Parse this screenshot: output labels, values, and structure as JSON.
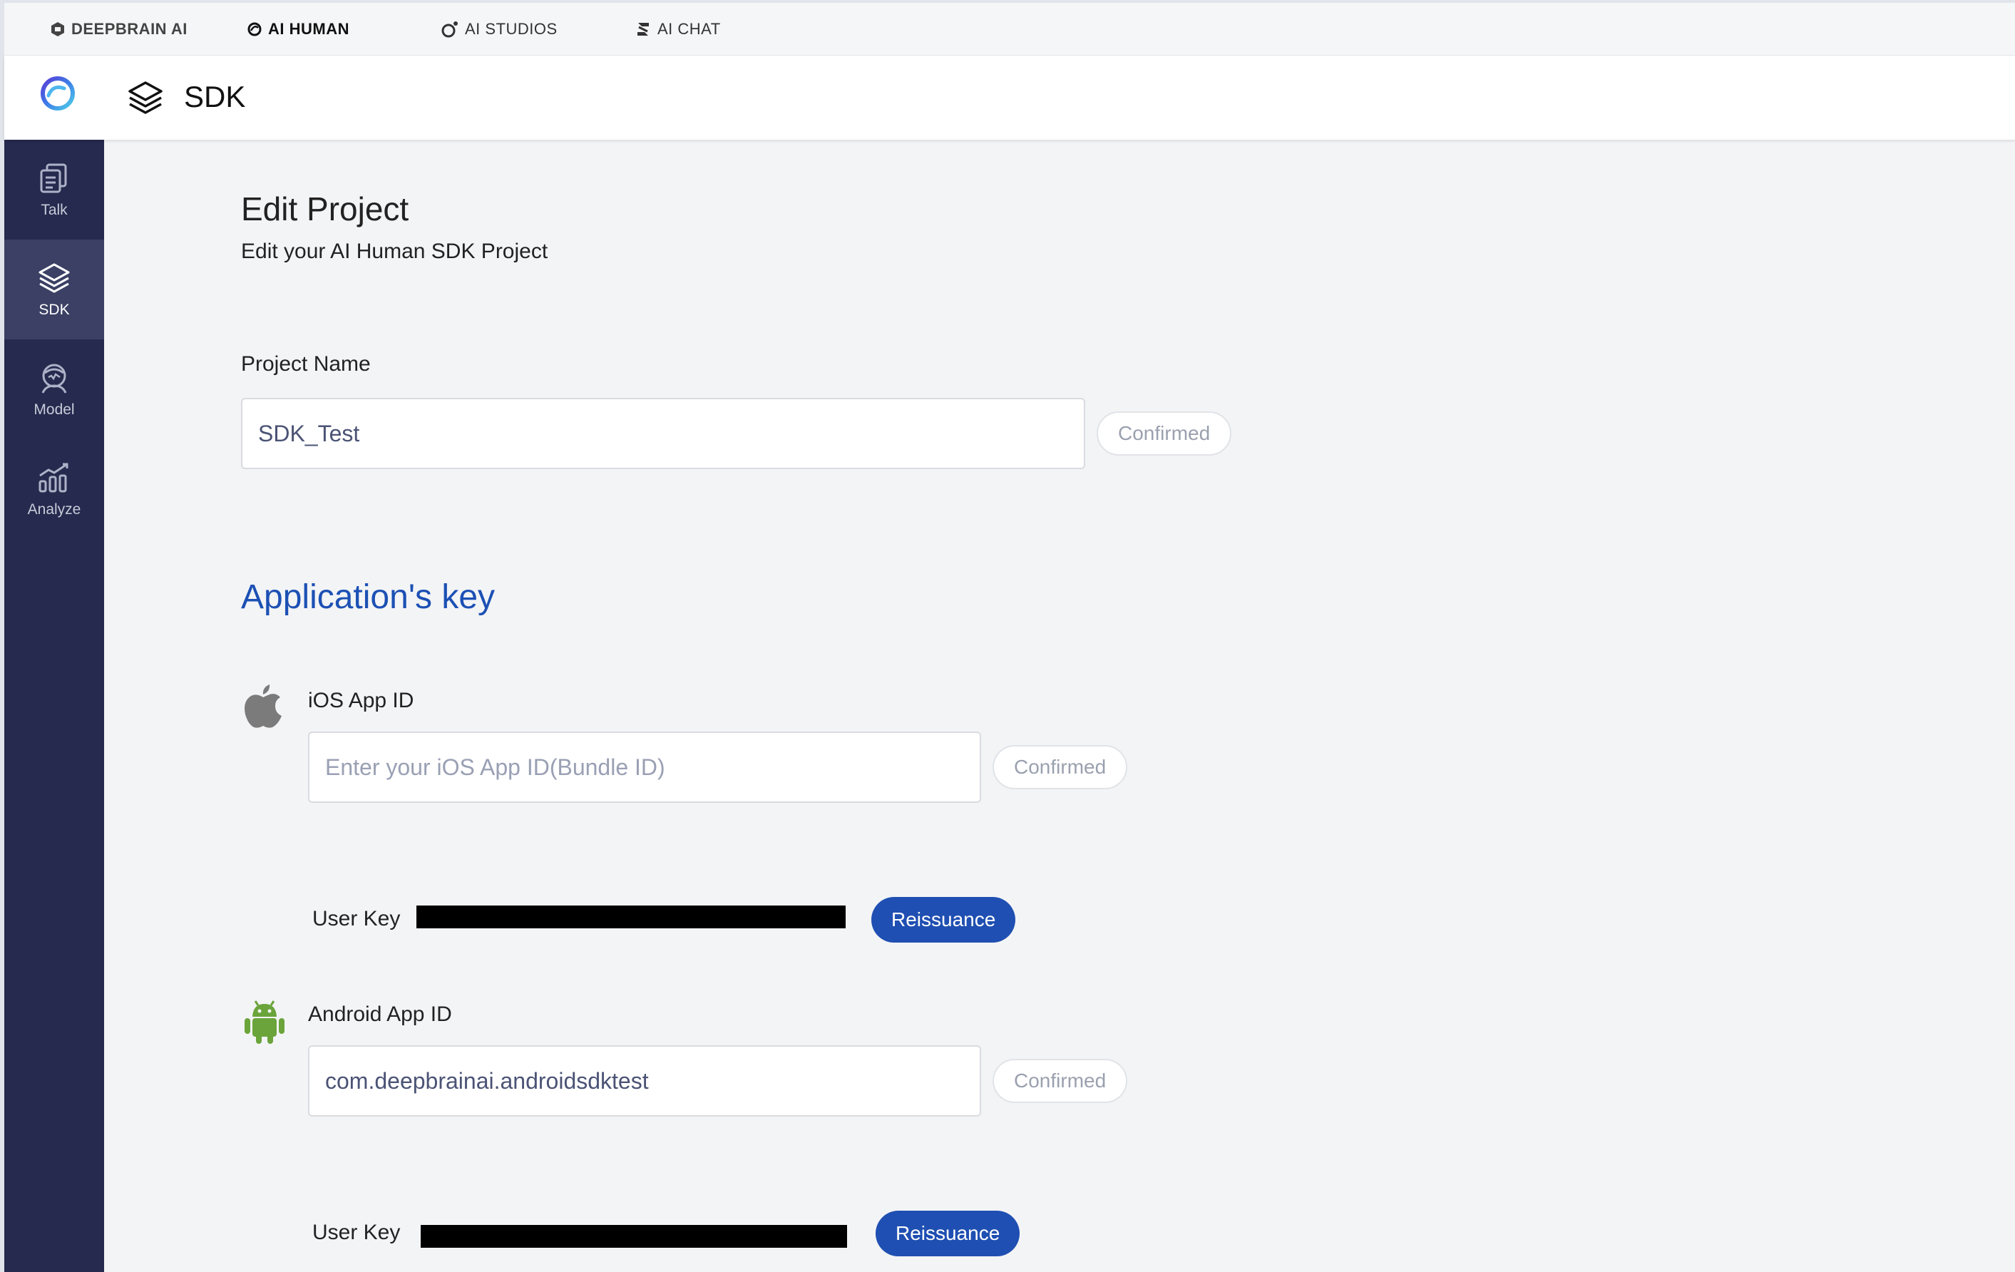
{
  "topbar": {
    "items": [
      {
        "label": "DEEPBRAIN AI",
        "icon": "deepbrain-logo-icon"
      },
      {
        "label": "AI HUMAN",
        "icon": "aihuman-logo-icon"
      },
      {
        "label": "AI STUDIOS",
        "icon": "aistudios-logo-icon"
      },
      {
        "label": "AI CHAT",
        "icon": "aichat-logo-icon"
      }
    ]
  },
  "header": {
    "title": "SDK",
    "icon": "layers-icon"
  },
  "sidebar": {
    "items": [
      {
        "label": "Talk",
        "icon": "talk-icon",
        "active": false
      },
      {
        "label": "SDK",
        "icon": "layers-icon",
        "active": true
      },
      {
        "label": "Model",
        "icon": "model-icon",
        "active": false
      },
      {
        "label": "Analyze",
        "icon": "analyze-icon",
        "active": false
      }
    ]
  },
  "page": {
    "title": "Edit Project",
    "subtitle": "Edit your AI Human SDK Project"
  },
  "project": {
    "label": "Project Name",
    "value": "SDK_Test",
    "confirm_label": "Confirmed"
  },
  "app_key": {
    "title": "Application's key",
    "ios": {
      "icon": "apple-icon",
      "label": "iOS App ID",
      "placeholder": "Enter your iOS App ID(Bundle ID)",
      "value": "",
      "confirm_label": "Confirmed",
      "user_key_label": "User Key",
      "reissue_label": "Reissuance"
    },
    "android": {
      "icon": "android-icon",
      "label": "Android App ID",
      "value": "com.deepbrainai.androidsdktest",
      "confirm_label": "Confirmed",
      "user_key_label": "User Key",
      "reissue_label": "Reissuance"
    }
  },
  "colors": {
    "sidebar_bg": "#252a4e",
    "sidebar_active": "#3b4064",
    "accent": "#1f4fb2",
    "section_title": "#1c50b4",
    "android_green": "#6aa43a",
    "apple_gray": "#7b7b7b"
  }
}
